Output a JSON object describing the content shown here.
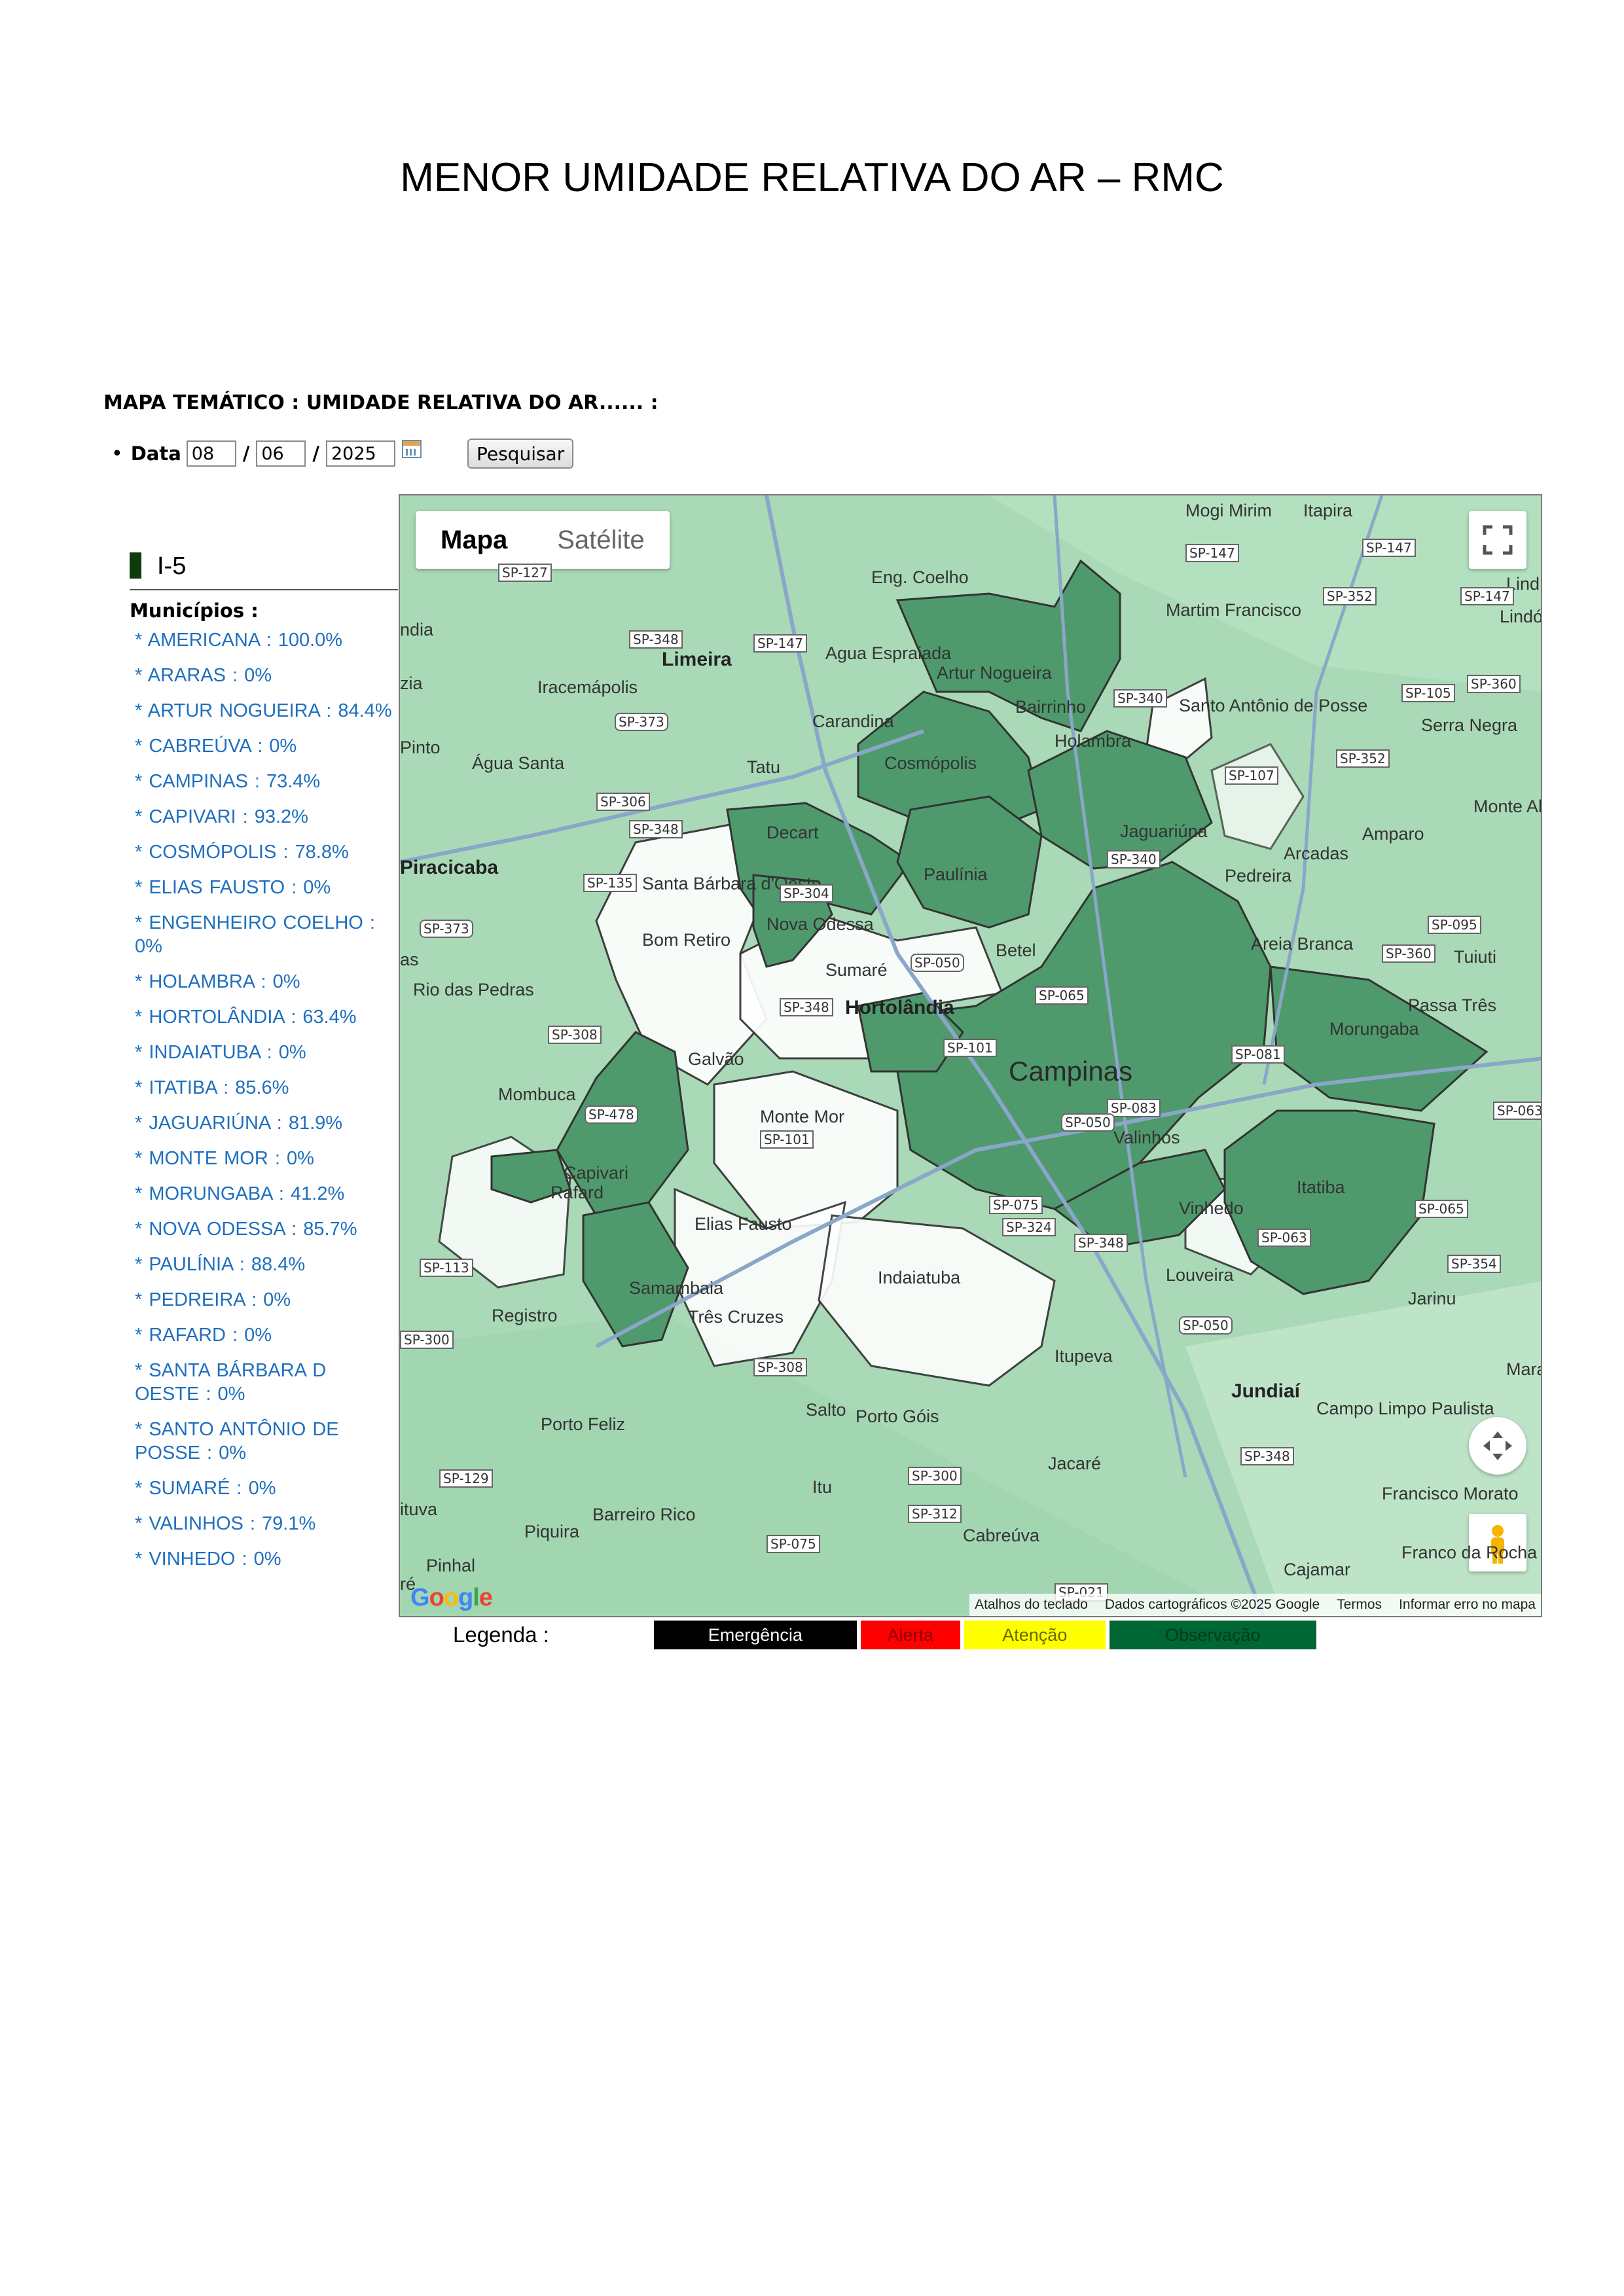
{
  "document": {
    "title": "MENOR UMIDADE RELATIVA DO AR – RMC"
  },
  "panel": {
    "title": "MAPA TEMÁTICO : UMIDADE RELATIVA DO AR......  :",
    "date_label": "Data",
    "day": "08",
    "month": "06",
    "year": "2025",
    "date_separator": "/",
    "search_button": "Pesquisar",
    "calendar_icon": "calendar-icon"
  },
  "indicator": {
    "label": "I-5",
    "color": "#0d3b0d"
  },
  "municipalities": {
    "title": "Municípios :",
    "items": [
      "* AMERICANA  :   100.0%",
      "* ARARAS  :   0%",
      "* ARTUR NOGUEIRA  :   84.4%",
      "* CABREÚVA  :   0%",
      "* CAMPINAS  :   73.4%",
      "* CAPIVARI  :   93.2%",
      "* COSMÓPOLIS  :   78.8%",
      "* ELIAS FAUSTO  :   0%",
      "* ENGENHEIRO COELHO  :   0%",
      "* HOLAMBRA  :   0%",
      "* HORTOLÂNDIA  :   63.4%",
      "* INDAIATUBA  :   0%",
      "* ITATIBA  :   85.6%",
      "* JAGUARIÚNA  :   81.9%",
      "* MONTE MOR  :   0%",
      "* MORUNGABA  :   41.2%",
      "* NOVA ODESSA  :   85.7%",
      "* PAULÍNIA  :   88.4%",
      "* PEDREIRA  :   0%",
      "* RAFARD  :   0%",
      "* SANTA BÁRBARA D OESTE  :   0%",
      "* SANTO ANTÔNIO DE POSSE  :   0%",
      "* SUMARÉ  :   0%",
      "* VALINHOS  :   79.1%",
      "* VINHEDO  :   0%"
    ]
  },
  "map": {
    "type_tabs": [
      "Mapa",
      "Satélite"
    ],
    "active_tab": "Mapa",
    "fullscreen_icon": "fullscreen-icon",
    "camera_control_icon": "camera-control-icon",
    "pegman_icon": "pegman-icon",
    "attribution": {
      "keyboard": "Atalhos do teclado",
      "data": "Dados cartográficos ©2025 Google",
      "terms": "Termos",
      "report": "Informar erro no mapa"
    },
    "google_logo": [
      "G",
      "o",
      "o",
      "g",
      "l",
      "e"
    ],
    "colors": {
      "land": "#a9d9b6",
      "highlight": "#4f9a6c",
      "white_area": "#ffffff",
      "border": "#333333",
      "road": "#8aa6c8"
    },
    "labels": [
      "Mogi Mirim",
      "Itapira",
      "Eng. Coelho",
      "Martim Francisco",
      "Lindó",
      "Lind",
      "Limeira",
      "Agua Espraiada",
      "Artur Nogueira",
      "Iracemápolis",
      "Carandina",
      "Bairrinho",
      "Santo Antônio de Posse",
      "Serra Negra",
      "Água Santa",
      "Tatu",
      "Cosmópolis",
      "Holambra",
      "Monte Alegre do Sul",
      "Decart",
      "Jaguariúna",
      "Amparo",
      "Arcadas",
      "Piracicaba",
      "Santa Bárbara d'Oeste",
      "Paulínia",
      "Pedreira",
      "Nova Odessa",
      "Bom Retiro",
      "Sumaré",
      "Betel",
      "Areia Branca",
      "Tuiuti",
      "Rio das Pedras",
      "Hortolândia",
      "Passa Três",
      "Morungaba",
      "Galvão",
      "Campinas",
      "Mombuca",
      "Monte Mor",
      "Valinhos",
      "Capivari",
      "Rafard",
      "Vinhedo",
      "Itatiba",
      "Elias Fausto",
      "Indaiatuba",
      "Louveira",
      "Samambaia",
      "Jarinu",
      "Três Cruzes",
      "Registro",
      "Itupeva",
      "Mara",
      "Jundiaí",
      "Salto",
      "Porto Góis",
      "Campo Limpo Paulista",
      "Porto Feliz",
      "Jacaré",
      "Francisco Morato",
      "Itu",
      "Barreiro Rico",
      "Piquira",
      "Cabreúva",
      "Franco da Rocha",
      "Pinhal",
      "Cajamar",
      "ndia",
      "zia",
      "Pinto",
      "as",
      "ituva",
      "ré"
    ],
    "roads": [
      "SP-147",
      "SP-147",
      "SP-147",
      "SP-352",
      "SP-127",
      "SP-348",
      "SP-147",
      "SP-340",
      "SP-105",
      "SP-360",
      "SP-373",
      "SP-352",
      "SP-107",
      "SP-306",
      "SP-348",
      "SP-340",
      "SP-135",
      "SP-304",
      "SP-373",
      "SP-095",
      "SP-360",
      "SP-050",
      "SP-348",
      "SP-065",
      "SP-308",
      "SP-101",
      "SP-081",
      "SP-063",
      "SP-478",
      "SP-083",
      "SP-050",
      "SP-101",
      "SP-075",
      "SP-324",
      "SP-348",
      "SP-065",
      "SP-063",
      "SP-113",
      "SP-354",
      "SP-300",
      "SP-050",
      "SP-308",
      "SP-348",
      "SP-129",
      "SP-300",
      "SP-312",
      "SP-075",
      "SP-021"
    ]
  },
  "legend": {
    "title": "Legenda :",
    "items": [
      {
        "label": "Emergência",
        "bg": "#000000",
        "fg": "#ffffff"
      },
      {
        "label": "Alerta",
        "bg": "#ff0000",
        "fg": "#8b0000"
      },
      {
        "label": "Atenção",
        "bg": "#ffff00",
        "fg": "#6b6b00"
      },
      {
        "label": "Observação",
        "bg": "#006633",
        "fg": "#003d1e"
      }
    ]
  }
}
